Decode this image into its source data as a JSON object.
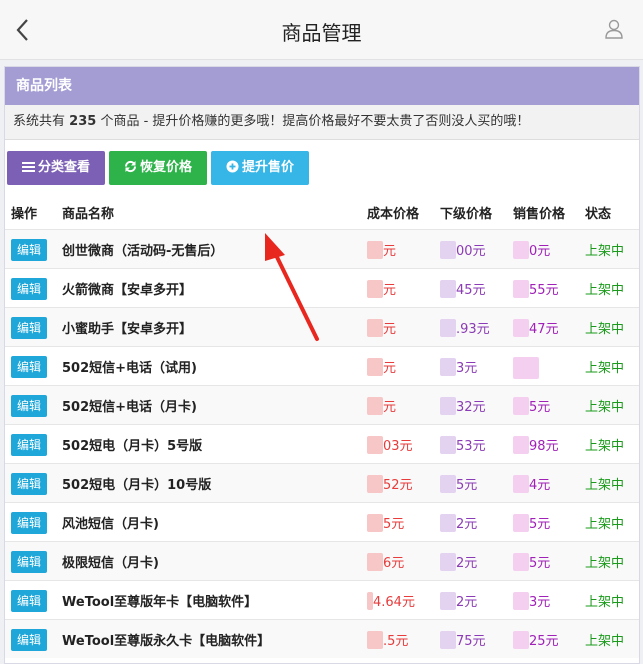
{
  "header": {
    "title": "商品管理",
    "back_icon": "chevron-left-icon",
    "user_icon": "user-icon"
  },
  "panel": {
    "title": "商品列表",
    "notice_prefix": "系统共有",
    "product_count": "235",
    "notice_suffix": "个商品 - 提升价格赚的更多哦！提高价格最好不要太贵了否则没人买的哦！"
  },
  "toolbar": {
    "category_label": "分类查看",
    "restore_label": "恢复价格",
    "raise_label": "提升售价"
  },
  "table": {
    "columns": [
      "操作",
      "商品名称",
      "成本价格",
      "下级价格",
      "销售价格",
      "状态"
    ],
    "rows": [
      {
        "action": "编辑",
        "name": "创世微商（活动码-无售后）",
        "cost": "元",
        "sub": "00元",
        "sale": "0元",
        "status": "上架中"
      },
      {
        "action": "编辑",
        "name": "火箭微商【安卓多开】",
        "cost": "元",
        "sub": "45元",
        "sale": "55元",
        "status": "上架中"
      },
      {
        "action": "编辑",
        "name": "小蜜助手【安卓多开】",
        "cost": "元",
        "sub": ".93元",
        "sale": "47元",
        "status": "上架中"
      },
      {
        "action": "编辑",
        "name": "502短信+电话（试用)",
        "cost": "元",
        "sub": "3元",
        "sale": "",
        "status": "上架中"
      },
      {
        "action": "编辑",
        "name": "502短信+电话（月卡)",
        "cost": "元",
        "sub": "32元",
        "sale": "5元",
        "status": "上架中"
      },
      {
        "action": "编辑",
        "name": "502短电（月卡）5号版",
        "cost": "03元",
        "sub": "53元",
        "sale": "98元",
        "status": "上架中"
      },
      {
        "action": "编辑",
        "name": "502短电（月卡）10号版",
        "cost": "52元",
        "sub": "5元",
        "sale": "4元",
        "status": "上架中"
      },
      {
        "action": "编辑",
        "name": "风池短信（月卡)",
        "cost": "5元",
        "sub": "2元",
        "sale": "5元",
        "status": "上架中"
      },
      {
        "action": "编辑",
        "name": "极限短信（月卡)",
        "cost": "6元",
        "sub": "2元",
        "sale": "5元",
        "status": "上架中"
      },
      {
        "action": "编辑",
        "name": "WeTool至尊版年卡【电脑软件】",
        "cost": "4.64元",
        "sub": "2元",
        "sale": "3元",
        "status": "上架中"
      },
      {
        "action": "编辑",
        "name": "WeTool至尊版永久卡【电脑软件】",
        "cost": ".5元",
        "sub": "75元",
        "sale": "25元",
        "status": "上架中"
      }
    ]
  },
  "colors": {
    "header_bar": "#a39dd3",
    "category_button": "#7c60b5",
    "restore_button": "#2eb34a",
    "raise_button": "#36b6e6",
    "edit_button": "#1fa7d9",
    "arrow": "#e8271f"
  }
}
